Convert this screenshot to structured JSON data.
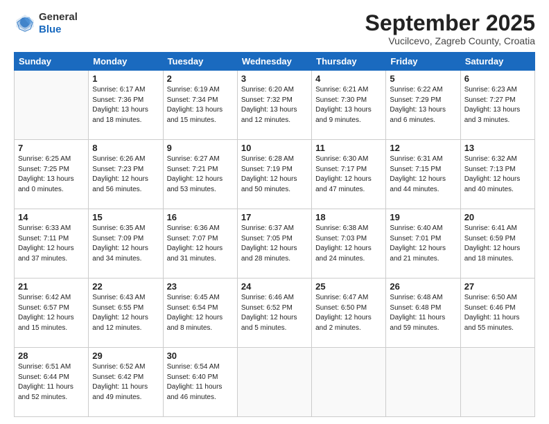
{
  "header": {
    "logo_general": "General",
    "logo_blue": "Blue",
    "month_title": "September 2025",
    "location": "Vucilcevo, Zagreb County, Croatia"
  },
  "days_of_week": [
    "Sunday",
    "Monday",
    "Tuesday",
    "Wednesday",
    "Thursday",
    "Friday",
    "Saturday"
  ],
  "weeks": [
    [
      {
        "day": "",
        "info": ""
      },
      {
        "day": "1",
        "info": "Sunrise: 6:17 AM\nSunset: 7:36 PM\nDaylight: 13 hours\nand 18 minutes."
      },
      {
        "day": "2",
        "info": "Sunrise: 6:19 AM\nSunset: 7:34 PM\nDaylight: 13 hours\nand 15 minutes."
      },
      {
        "day": "3",
        "info": "Sunrise: 6:20 AM\nSunset: 7:32 PM\nDaylight: 13 hours\nand 12 minutes."
      },
      {
        "day": "4",
        "info": "Sunrise: 6:21 AM\nSunset: 7:30 PM\nDaylight: 13 hours\nand 9 minutes."
      },
      {
        "day": "5",
        "info": "Sunrise: 6:22 AM\nSunset: 7:29 PM\nDaylight: 13 hours\nand 6 minutes."
      },
      {
        "day": "6",
        "info": "Sunrise: 6:23 AM\nSunset: 7:27 PM\nDaylight: 13 hours\nand 3 minutes."
      }
    ],
    [
      {
        "day": "7",
        "info": "Sunrise: 6:25 AM\nSunset: 7:25 PM\nDaylight: 13 hours\nand 0 minutes."
      },
      {
        "day": "8",
        "info": "Sunrise: 6:26 AM\nSunset: 7:23 PM\nDaylight: 12 hours\nand 56 minutes."
      },
      {
        "day": "9",
        "info": "Sunrise: 6:27 AM\nSunset: 7:21 PM\nDaylight: 12 hours\nand 53 minutes."
      },
      {
        "day": "10",
        "info": "Sunrise: 6:28 AM\nSunset: 7:19 PM\nDaylight: 12 hours\nand 50 minutes."
      },
      {
        "day": "11",
        "info": "Sunrise: 6:30 AM\nSunset: 7:17 PM\nDaylight: 12 hours\nand 47 minutes."
      },
      {
        "day": "12",
        "info": "Sunrise: 6:31 AM\nSunset: 7:15 PM\nDaylight: 12 hours\nand 44 minutes."
      },
      {
        "day": "13",
        "info": "Sunrise: 6:32 AM\nSunset: 7:13 PM\nDaylight: 12 hours\nand 40 minutes."
      }
    ],
    [
      {
        "day": "14",
        "info": "Sunrise: 6:33 AM\nSunset: 7:11 PM\nDaylight: 12 hours\nand 37 minutes."
      },
      {
        "day": "15",
        "info": "Sunrise: 6:35 AM\nSunset: 7:09 PM\nDaylight: 12 hours\nand 34 minutes."
      },
      {
        "day": "16",
        "info": "Sunrise: 6:36 AM\nSunset: 7:07 PM\nDaylight: 12 hours\nand 31 minutes."
      },
      {
        "day": "17",
        "info": "Sunrise: 6:37 AM\nSunset: 7:05 PM\nDaylight: 12 hours\nand 28 minutes."
      },
      {
        "day": "18",
        "info": "Sunrise: 6:38 AM\nSunset: 7:03 PM\nDaylight: 12 hours\nand 24 minutes."
      },
      {
        "day": "19",
        "info": "Sunrise: 6:40 AM\nSunset: 7:01 PM\nDaylight: 12 hours\nand 21 minutes."
      },
      {
        "day": "20",
        "info": "Sunrise: 6:41 AM\nSunset: 6:59 PM\nDaylight: 12 hours\nand 18 minutes."
      }
    ],
    [
      {
        "day": "21",
        "info": "Sunrise: 6:42 AM\nSunset: 6:57 PM\nDaylight: 12 hours\nand 15 minutes."
      },
      {
        "day": "22",
        "info": "Sunrise: 6:43 AM\nSunset: 6:55 PM\nDaylight: 12 hours\nand 12 minutes."
      },
      {
        "day": "23",
        "info": "Sunrise: 6:45 AM\nSunset: 6:54 PM\nDaylight: 12 hours\nand 8 minutes."
      },
      {
        "day": "24",
        "info": "Sunrise: 6:46 AM\nSunset: 6:52 PM\nDaylight: 12 hours\nand 5 minutes."
      },
      {
        "day": "25",
        "info": "Sunrise: 6:47 AM\nSunset: 6:50 PM\nDaylight: 12 hours\nand 2 minutes."
      },
      {
        "day": "26",
        "info": "Sunrise: 6:48 AM\nSunset: 6:48 PM\nDaylight: 11 hours\nand 59 minutes."
      },
      {
        "day": "27",
        "info": "Sunrise: 6:50 AM\nSunset: 6:46 PM\nDaylight: 11 hours\nand 55 minutes."
      }
    ],
    [
      {
        "day": "28",
        "info": "Sunrise: 6:51 AM\nSunset: 6:44 PM\nDaylight: 11 hours\nand 52 minutes."
      },
      {
        "day": "29",
        "info": "Sunrise: 6:52 AM\nSunset: 6:42 PM\nDaylight: 11 hours\nand 49 minutes."
      },
      {
        "day": "30",
        "info": "Sunrise: 6:54 AM\nSunset: 6:40 PM\nDaylight: 11 hours\nand 46 minutes."
      },
      {
        "day": "",
        "info": ""
      },
      {
        "day": "",
        "info": ""
      },
      {
        "day": "",
        "info": ""
      },
      {
        "day": "",
        "info": ""
      }
    ]
  ]
}
